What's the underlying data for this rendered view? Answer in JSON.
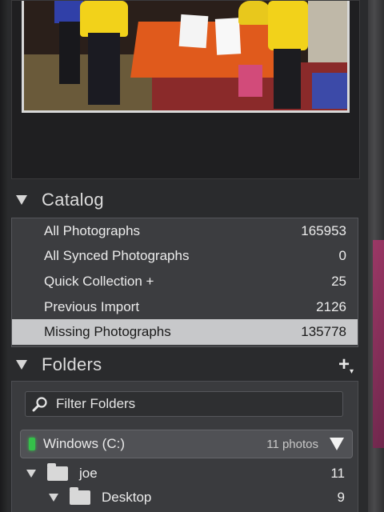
{
  "catalog": {
    "title": "Catalog",
    "items": [
      {
        "label": "All Photographs",
        "count": "165953"
      },
      {
        "label": "All Synced Photographs",
        "count": "0"
      },
      {
        "label": "Quick Collection +",
        "count": "25"
      },
      {
        "label": "Previous Import",
        "count": "2126"
      },
      {
        "label": "Missing Photographs",
        "count": "135778"
      }
    ]
  },
  "folders": {
    "title": "Folders",
    "add_label": "+",
    "filter_placeholder": "Filter Folders",
    "volume": {
      "name": "Windows (C:)",
      "info": "11 photos"
    },
    "tree": [
      {
        "name": "joe",
        "count": "11"
      },
      {
        "name": "Desktop",
        "count": "9"
      }
    ]
  },
  "colors": {
    "selected_row": "#c7c8ca",
    "volume_led": "#35c04a",
    "panel_bg": "#3c3d40"
  },
  "icons": [
    "search-icon",
    "folder-icon",
    "disclosure-triangle-icon",
    "chevron-down-icon",
    "plus-icon"
  ]
}
